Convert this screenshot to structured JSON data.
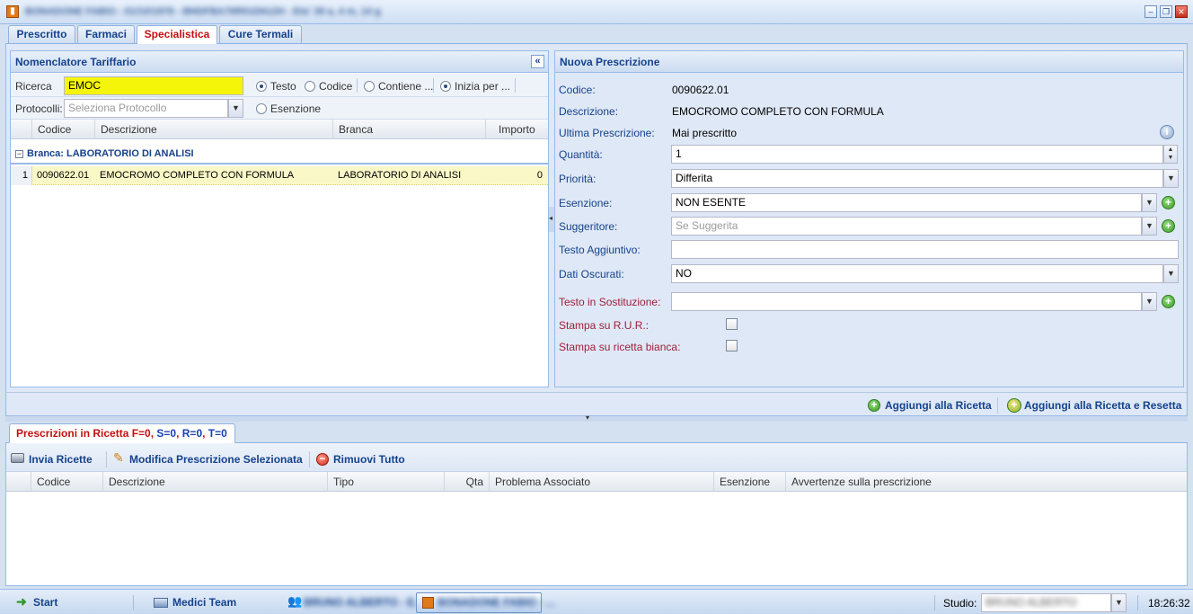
{
  "window": {
    "title": "BONADONE FABIO - 01/10/1976 - BNDFBA76R01D612H - Eta' 39 a, 4 m, 14 g",
    "app_icon": "patient-card-icon"
  },
  "tabs": [
    {
      "label": "Prescritto"
    },
    {
      "label": "Farmaci"
    },
    {
      "label": "Specialistica"
    },
    {
      "label": "Cure Termali"
    }
  ],
  "nomenclatore": {
    "title": "Nomenclatore Tariffario",
    "collapse_label": "«",
    "search_label": "Ricerca",
    "search_value": "EMOC",
    "radios": [
      {
        "label": "Testo",
        "checked": true
      },
      {
        "label": "Codice",
        "checked": false
      },
      {
        "label": "Contiene ...",
        "checked": false
      },
      {
        "label": "Inizia per ...",
        "checked": true
      }
    ],
    "protocolli_label": "Protocolli:",
    "protocolli_placeholder": "Seleziona Protocollo",
    "esenzione_label": "Esenzione",
    "columns": [
      "Codice",
      "Descrizione",
      "Branca",
      "Importo"
    ],
    "group_label": "Branca: LABORATORIO DI ANALISI",
    "rows": [
      {
        "num": "1",
        "codice": "0090622.01",
        "descrizione": "EMOCROMO COMPLETO CON FORMULA",
        "branca": "LABORATORIO DI ANALISI",
        "importo": "0"
      }
    ]
  },
  "nuova": {
    "title": "Nuova Prescrizione",
    "codice_label": "Codice:",
    "codice_value": "0090622.01",
    "descrizione_label": "Descrizione:",
    "descrizione_value": "EMOCROMO COMPLETO CON FORMULA",
    "ultima_label": "Ultima Prescrizione:",
    "ultima_value": "Mai prescritto",
    "quantita_label": "Quantità:",
    "quantita_value": "1",
    "priorita_label": "Priorità:",
    "priorita_value": "Differita",
    "esenzione_label": "Esenzione:",
    "esenzione_value": "NON ESENTE",
    "suggeritore_label": "Suggeritore:",
    "suggeritore_placeholder": "Se Suggerita",
    "testo_agg_label": "Testo Aggiuntivo:",
    "testo_agg_value": "",
    "dati_oscurati_label": "Dati Oscurati:",
    "dati_oscurati_value": "NO",
    "testo_sost_label": "Testo in Sostituzione:",
    "stampa_rur_label": "Stampa su R.U.R.:",
    "stampa_bianca_label": "Stampa su ricetta bianca:"
  },
  "actions": {
    "aggiungi": "Aggiungi alla Ricetta",
    "aggiungi_reset": "Aggiungi alla Ricetta e Resetta"
  },
  "prescrizioni": {
    "tab_prefix": "Prescrizioni in Ricetta ",
    "counts": [
      {
        "text": "F=0",
        "color": "#c41010"
      },
      {
        "text": ", ",
        "color": "#c41010"
      },
      {
        "text": "S=0",
        "color": "#1a3fb5"
      },
      {
        "text": ", ",
        "color": "#c41010"
      },
      {
        "text": "R=0",
        "color": "#1a3fb5"
      },
      {
        "text": ", ",
        "color": "#c41010"
      },
      {
        "text": "T=0",
        "color": "#1a3fb5"
      }
    ],
    "invia": "Invia Ricette",
    "modifica": "Modifica Prescrizione Selezionata",
    "rimuovi": "Rimuovi Tutto",
    "columns": [
      "Codice",
      "Descrizione",
      "Tipo",
      "Qta",
      "Problema Associato",
      "Esenzione",
      "Avvertenze sulla prescrizione"
    ]
  },
  "taskbar": {
    "start": "Start",
    "medici": "Medici Team",
    "doctor_task": "BRUNO ALBERTO - E..",
    "patient_task": "BONADONE FABIO - ...",
    "studio_label": "Studio:",
    "studio_value": "BRUNO ALBERTO",
    "clock": "18:26:32"
  },
  "colors": {
    "accent": "#15428b",
    "active_tab": "#c41010",
    "highlight_field": "#f5f50a",
    "selected_row": "#fbf8c8"
  }
}
